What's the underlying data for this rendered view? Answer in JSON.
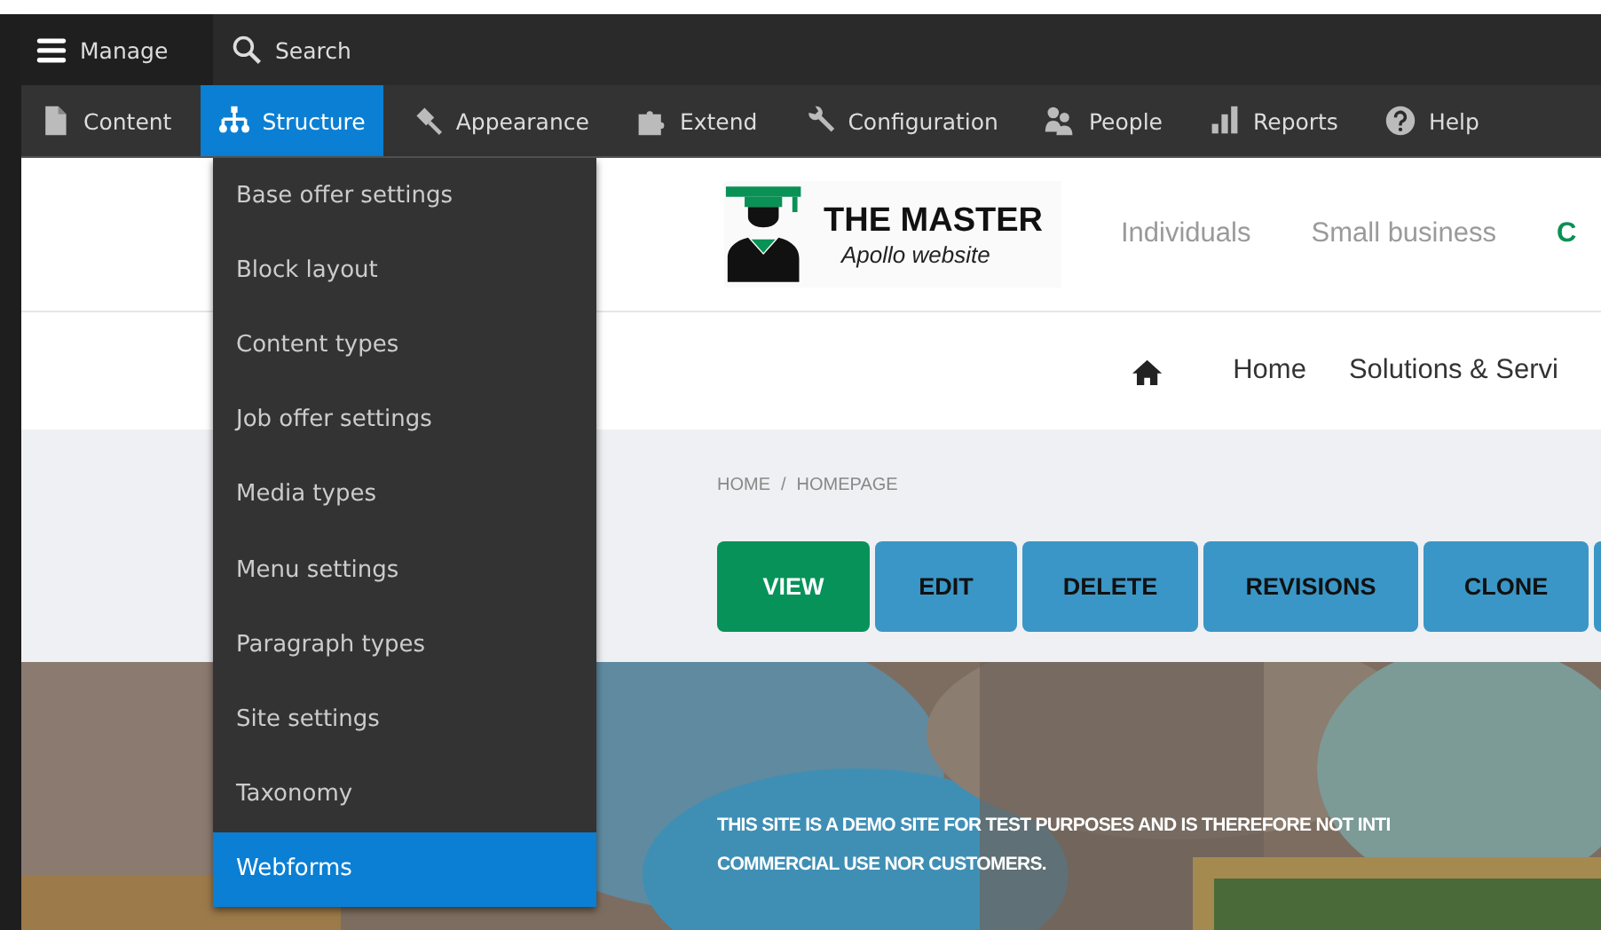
{
  "toolbar": {
    "primary": [
      {
        "label": "Manage",
        "kind": "menu",
        "selected": false
      },
      {
        "label": "Search",
        "kind": "search",
        "selected": false
      }
    ],
    "tabs": [
      {
        "label": "Content",
        "kind": "document",
        "selected": false
      },
      {
        "label": "Structure",
        "kind": "sitemap",
        "selected": true
      },
      {
        "label": "Appearance",
        "kind": "brush",
        "selected": false
      },
      {
        "label": "Extend",
        "kind": "puzzle",
        "selected": false
      },
      {
        "label": "Configuration",
        "kind": "wrench",
        "selected": false
      },
      {
        "label": "People",
        "kind": "people",
        "selected": false
      },
      {
        "label": "Reports",
        "kind": "bars",
        "selected": false
      },
      {
        "label": "Help",
        "kind": "help",
        "selected": false
      }
    ]
  },
  "dropdown": {
    "items": [
      {
        "label": "Base offer settings",
        "selected": false
      },
      {
        "label": "Block layout",
        "selected": false
      },
      {
        "label": "Content types",
        "selected": false
      },
      {
        "label": "Job offer settings",
        "selected": false
      },
      {
        "label": "Media types",
        "selected": false
      },
      {
        "label": "Menu settings",
        "selected": false
      },
      {
        "label": "Paragraph types",
        "selected": false
      },
      {
        "label": "Site settings",
        "selected": false
      },
      {
        "label": "Taxonomy",
        "selected": false
      },
      {
        "label": "Webforms",
        "selected": true
      }
    ]
  },
  "site": {
    "logo": {
      "title": "THE MASTER",
      "subtitle": "Apollo website"
    },
    "audience_links": [
      {
        "label": "Individuals",
        "selected": false
      },
      {
        "label": "Small business",
        "selected": false
      },
      {
        "label": "C",
        "selected": true
      }
    ],
    "main_nav": [
      "Home",
      "Solutions & Servi"
    ],
    "breadcrumb": {
      "items": [
        "HOME",
        "HOMEPAGE"
      ],
      "separator": "/"
    },
    "actions": [
      {
        "label": "VIEW",
        "selected": true
      },
      {
        "label": "EDIT",
        "selected": false
      },
      {
        "label": "DELETE",
        "selected": false
      },
      {
        "label": "REVISIONS",
        "selected": false
      },
      {
        "label": "CLONE",
        "selected": false
      }
    ],
    "hero": {
      "kind": "picture",
      "notice": [
        "THIS SITE IS A DEMO SITE FOR TEST PURPOSES AND IS THEREFORE NOT INTI",
        "COMMERCIAL USE NOR CUSTOMERS."
      ]
    }
  }
}
